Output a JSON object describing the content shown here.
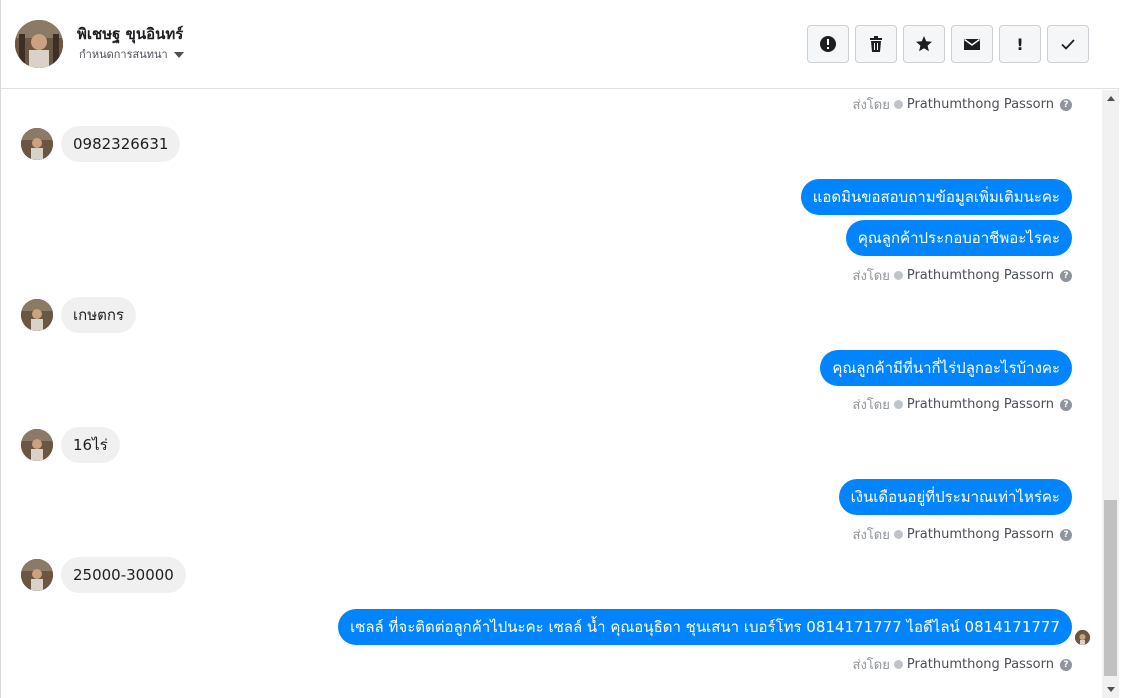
{
  "contact": {
    "name": "พิเชษฐ ขุนอินทร์",
    "assign_label": "กำหนดการสนทนา"
  },
  "actions": [
    {
      "icon": "alert-circle-icon"
    },
    {
      "icon": "trash-icon"
    },
    {
      "icon": "star-icon"
    },
    {
      "icon": "envelope-icon"
    },
    {
      "icon": "exclamation-icon",
      "text": "!"
    },
    {
      "icon": "checkmark-icon"
    }
  ],
  "sent_by": {
    "prefix": "ส่งโดย",
    "agent": "Prathumthong Passorn",
    "help": "?"
  },
  "messages": {
    "in_1": "0982326631",
    "out_1a": "แอดมินขอสอบถามข้อมูลเพิ่มเติมนะคะ",
    "out_1b": "คุณลูกค้าประกอบอาชีพอะไรคะ",
    "in_2": "เกษตกร",
    "out_2": "คุณลูกค้ามีที่นากี่ไร่ปลูกอะไรบ้างคะ",
    "in_3": "16ไร่",
    "out_3": "เงินเดือนอยู่ที่ประมาณเท่าไหร่คะ",
    "in_4": "25000-30000",
    "out_4": "เซลล์ ที่จะติดต่อลูกค้าไปนะคะ เซลล์ น้ำ คุณอนุธิดา ชุนเสนา เบอร์โทร 0814171777 ไอดีไลน์ 0814171777"
  },
  "colors": {
    "bubble_out": "#0084ff",
    "bubble_in": "#f1f0f0",
    "meta": "#90949c"
  }
}
